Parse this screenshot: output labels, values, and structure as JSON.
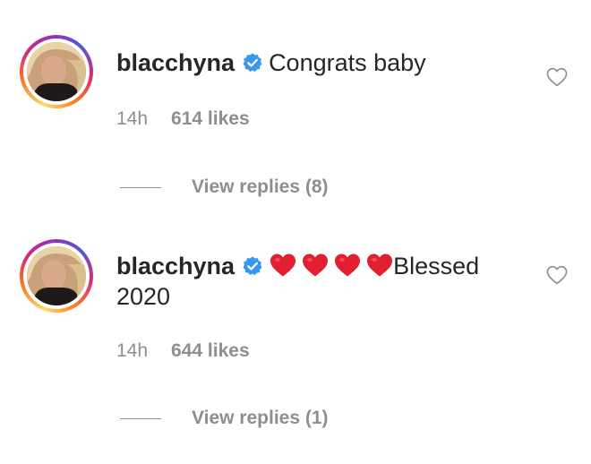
{
  "comments": [
    {
      "username": "blacchyna",
      "text": "Congrats baby",
      "time": "14h",
      "likes": "614 likes",
      "replies": "View replies (8)"
    },
    {
      "username": "blacchyna",
      "emoji_count": 4,
      "text": "Blessed",
      "text_line2": "2020",
      "time": "14h",
      "likes": "644 likes",
      "replies": "View replies (1)"
    }
  ],
  "icons": {
    "verified": "verified-badge-icon",
    "like": "heart-outline-icon",
    "emoji": "red-heart-emoji"
  },
  "colors": {
    "text": "#262626",
    "secondary": "#8e8e8e",
    "verified": "#3897f0",
    "emoji_heart": "#e0202e"
  }
}
